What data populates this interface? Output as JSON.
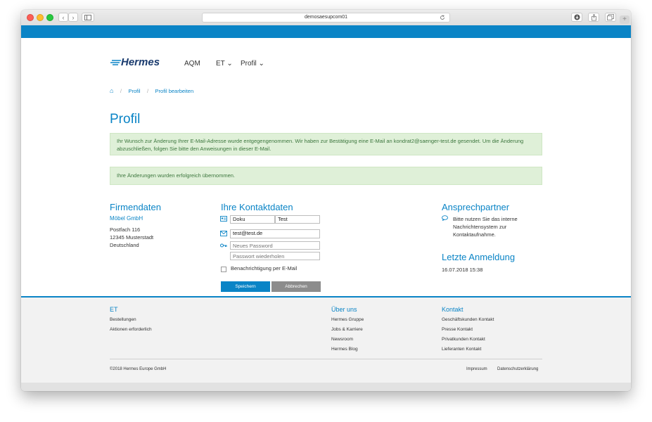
{
  "browser": {
    "url": "demosaesupcom01",
    "nav_back": "‹",
    "nav_forward": "›"
  },
  "header": {
    "logo": "Hermes",
    "nav": [
      {
        "label": "AQM"
      },
      {
        "label": "ET ⌄"
      },
      {
        "label": "Profil ⌄"
      }
    ]
  },
  "breadcrumb": {
    "home_icon": "⌂",
    "sep": "/",
    "items": [
      "Profil",
      "Profil bearbeiten"
    ]
  },
  "page": {
    "title": "Profil",
    "alert_email": "Ihr Wunsch zur Änderung Ihrer E-Mail-Adresse wurde entgegengenommen. Wir haben zur Bestätigung eine E-Mail an kondrat2@saenger-test.de gesendet. Um die Änderung abzuschließen, folgen Sie bitte den Anweisungen in dieser E-Mail.",
    "alert_success": "Ihre Änderungen wurden erfolgreich übernommen."
  },
  "company": {
    "heading": "Firmendaten",
    "name": "Möbel GmbH",
    "address_1": "Postfach 116",
    "address_2": "12345 Musterstadt",
    "address_3": "Deutschland"
  },
  "contact": {
    "heading": "Ihre Kontaktdaten",
    "first_name": "Doku",
    "last_name": "Test",
    "email": "test@test.de",
    "password_placeholder": "Neues Password",
    "password_repeat_placeholder": "Passwort wiederholen",
    "notify_label": "Benachrichtigung per E-Mail",
    "save_label": "Speichern",
    "cancel_label": "Abbrechen"
  },
  "partner": {
    "heading": "Ansprechpartner",
    "text_1": "Bitte nutzen Sie das interne",
    "text_2": "Nachrichtensystem zur",
    "text_3": "Kontaktaufnahme."
  },
  "last_login": {
    "heading": "Letzte Anmeldung",
    "value": "16.07.2018 15:38"
  },
  "footer": {
    "col1": {
      "title": "ET",
      "links": [
        "Bestellungen",
        "Aktionen erforderlich"
      ]
    },
    "col2": {
      "title": "Über uns",
      "links": [
        "Hermes Gruppe",
        "Jobs & Karriere",
        "Newsroom",
        "Hermes Blog"
      ]
    },
    "col3": {
      "title": "Kontakt",
      "links": [
        "Geschäftskunden Kontakt",
        "Presse Kontakt",
        "Privatkunden Kontakt",
        "Lieferanten Kontakt"
      ]
    },
    "copyright": "©2018 Hermes Europe GmbH",
    "impressum": "Impressum",
    "privacy": "Datenschutzerklärung"
  },
  "colors": {
    "accent": "#0a84c6",
    "alert_bg": "#dff0d8",
    "alert_text": "#3c763d",
    "cancel_button": "#8c8c8c"
  }
}
